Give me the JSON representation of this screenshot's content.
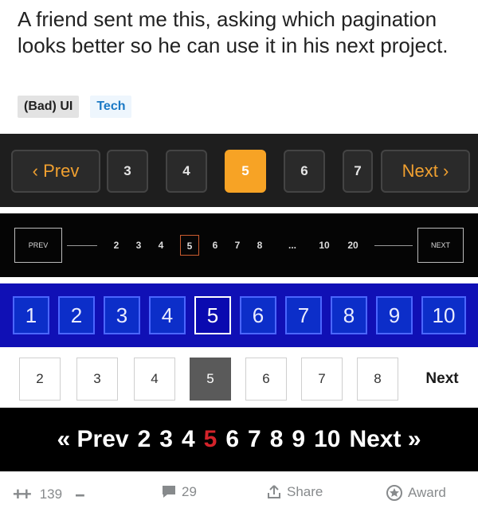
{
  "post": {
    "title": "A friend sent me this, asking which pagination looks better so he can use it in his next project.",
    "flairs": [
      "(Bad) UI",
      "Tech"
    ]
  },
  "strip1": {
    "prev": "‹ Prev",
    "pages": [
      "3",
      "4",
      "5",
      "6",
      "7"
    ],
    "active": "5",
    "next": "Next ›",
    "accent": "#f7a325"
  },
  "strip2": {
    "prev": "PREV",
    "pages": [
      "2",
      "3",
      "4",
      "5",
      "6",
      "7",
      "8",
      "...",
      "10",
      "20"
    ],
    "active": "5",
    "next": "NEXT"
  },
  "strip3": {
    "pages": [
      "1",
      "2",
      "3",
      "4",
      "5",
      "6",
      "7",
      "8",
      "9",
      "10"
    ],
    "active": "5",
    "background": "#1010b5"
  },
  "strip4": {
    "pages": [
      "2",
      "3",
      "4",
      "5",
      "6",
      "7",
      "8"
    ],
    "active": "5",
    "next": "Next"
  },
  "strip5": {
    "prev": "« Prev",
    "pages": [
      "2",
      "3",
      "4",
      "5",
      "6",
      "7",
      "8",
      "9",
      "10"
    ],
    "active": "5",
    "next": "Next »",
    "active_color": "#d4232a"
  },
  "footer": {
    "upvote_icon": "++",
    "score": "139",
    "downvote_icon": "--",
    "comments": "29",
    "share": "Share",
    "award": "Award"
  }
}
